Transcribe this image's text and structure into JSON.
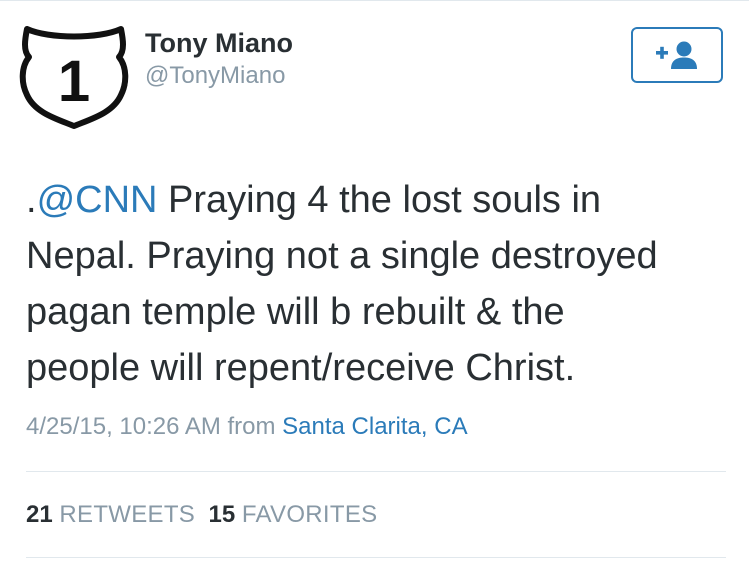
{
  "header": {
    "display_name": "Tony Miano",
    "handle": "@TonyMiano",
    "avatar_text": "1",
    "follow_icon": "follow-user-icon"
  },
  "tweet": {
    "prefix": ".",
    "mention": "@CNN",
    "lines": [
      " Praying 4 the lost souls in",
      "Nepal. Praying not a single destroyed",
      "pagan temple will b rebuilt & the",
      "people will repent/receive Christ."
    ]
  },
  "meta": {
    "timestamp": "4/25/15, 10:26 AM",
    "from_label": " from ",
    "location": "Santa Clarita, CA"
  },
  "stats": {
    "retweets_count": "21",
    "retweets_label": "RETWEETS",
    "favorites_count": "15",
    "favorites_label": "FAVORITES"
  },
  "colors": {
    "link": "#2b7bb9",
    "text": "#292f33",
    "muted": "#8899a6",
    "divider": "#e1e8ed"
  }
}
